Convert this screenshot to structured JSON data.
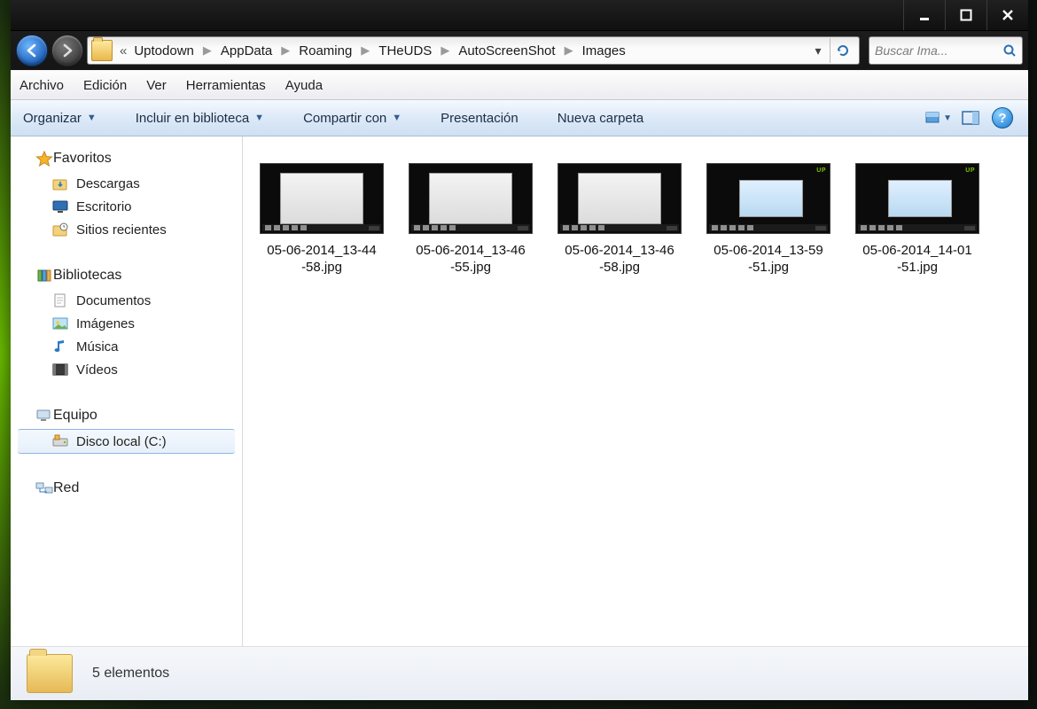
{
  "breadcrumbs": [
    "Uptodown",
    "AppData",
    "Roaming",
    "THeUDS",
    "AutoScreenShot",
    "Images"
  ],
  "search_placeholder": "Buscar Ima...",
  "menubar": {
    "archivo": "Archivo",
    "edicion": "Edición",
    "ver": "Ver",
    "herramientas": "Herramientas",
    "ayuda": "Ayuda"
  },
  "toolbar": {
    "organizar": "Organizar",
    "incluir": "Incluir en biblioteca",
    "compartir": "Compartir con",
    "presentacion": "Presentación",
    "nueva": "Nueva carpeta"
  },
  "sidebar": {
    "favoritos": {
      "label": "Favoritos",
      "items": [
        "Descargas",
        "Escritorio",
        "Sitios recientes"
      ]
    },
    "bibliotecas": {
      "label": "Bibliotecas",
      "items": [
        "Documentos",
        "Imágenes",
        "Música",
        "Vídeos"
      ]
    },
    "equipo": {
      "label": "Equipo",
      "items": [
        "Disco local (C:)"
      ]
    },
    "red": {
      "label": "Red"
    }
  },
  "files": [
    {
      "name": "05-06-2014_13-44\n-58.jpg",
      "kind": "explorer"
    },
    {
      "name": "05-06-2014_13-46\n-55.jpg",
      "kind": "explorer"
    },
    {
      "name": "05-06-2014_13-46\n-58.jpg",
      "kind": "explorer"
    },
    {
      "name": "05-06-2014_13-59\n-51.jpg",
      "kind": "dialog"
    },
    {
      "name": "05-06-2014_14-01\n-51.jpg",
      "kind": "dialog"
    }
  ],
  "status": "5 elementos"
}
